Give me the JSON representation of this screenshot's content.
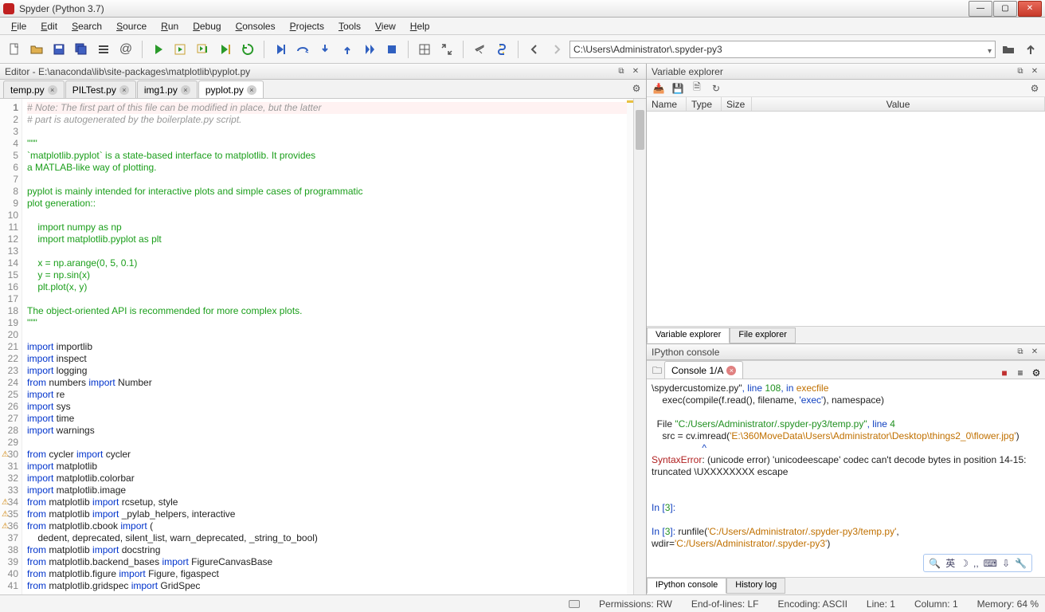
{
  "window": {
    "title": "Spyder (Python 3.7)"
  },
  "menubar": [
    "File",
    "Edit",
    "Search",
    "Source",
    "Run",
    "Debug",
    "Consoles",
    "Projects",
    "Tools",
    "View",
    "Help"
  ],
  "path": "C:\\Users\\Administrator\\.spyder-py3",
  "editor": {
    "pane_title": "Editor - E:\\anaconda\\lib\\site-packages\\matplotlib\\pyplot.py",
    "tabs": [
      {
        "label": "temp.py",
        "active": false
      },
      {
        "label": "PILTest.py",
        "active": false
      },
      {
        "label": "img1.py",
        "active": false
      },
      {
        "label": "pyplot.py",
        "active": true
      }
    ],
    "lines": [
      {
        "n": 1,
        "cls": "c-comm",
        "text": "# Note: The first part of this file can be modified in place, but the latter",
        "first": true
      },
      {
        "n": 2,
        "cls": "c-comm",
        "text": "# part is autogenerated by the boilerplate.py script."
      },
      {
        "n": 3,
        "cls": "",
        "text": ""
      },
      {
        "n": 4,
        "cls": "c-str",
        "text": "\"\"\""
      },
      {
        "n": 5,
        "cls": "c-str",
        "text": "`matplotlib.pyplot` is a state-based interface to matplotlib. It provides"
      },
      {
        "n": 6,
        "cls": "c-str",
        "text": "a MATLAB-like way of plotting."
      },
      {
        "n": 7,
        "cls": "",
        "text": ""
      },
      {
        "n": 8,
        "cls": "c-str",
        "text": "pyplot is mainly intended for interactive plots and simple cases of programmatic"
      },
      {
        "n": 9,
        "cls": "c-str",
        "text": "plot generation::"
      },
      {
        "n": 10,
        "cls": "",
        "text": ""
      },
      {
        "n": 11,
        "cls": "c-str",
        "text": "    import numpy as np"
      },
      {
        "n": 12,
        "cls": "c-str",
        "text": "    import matplotlib.pyplot as plt"
      },
      {
        "n": 13,
        "cls": "",
        "text": ""
      },
      {
        "n": 14,
        "cls": "c-str",
        "text": "    x = np.arange(0, 5, 0.1)"
      },
      {
        "n": 15,
        "cls": "c-str",
        "text": "    y = np.sin(x)"
      },
      {
        "n": 16,
        "cls": "c-str",
        "text": "    plt.plot(x, y)"
      },
      {
        "n": 17,
        "cls": "",
        "text": ""
      },
      {
        "n": 18,
        "cls": "c-str",
        "text": "The object-oriented API is recommended for more complex plots."
      },
      {
        "n": 19,
        "cls": "c-str",
        "text": "\"\"\""
      },
      {
        "n": 20,
        "cls": "",
        "text": ""
      },
      {
        "n": 21,
        "cls": "mix",
        "html": "<span class=c-kw>import</span> importlib"
      },
      {
        "n": 22,
        "cls": "mix",
        "html": "<span class=c-kw>import</span> inspect"
      },
      {
        "n": 23,
        "cls": "mix",
        "html": "<span class=c-kw>import</span> logging"
      },
      {
        "n": 24,
        "cls": "mix",
        "html": "<span class=c-kw>from</span> numbers <span class=c-kw>import</span> Number"
      },
      {
        "n": 25,
        "cls": "mix",
        "html": "<span class=c-kw>import</span> re"
      },
      {
        "n": 26,
        "cls": "mix",
        "html": "<span class=c-kw>import</span> sys"
      },
      {
        "n": 27,
        "cls": "mix",
        "html": "<span class=c-kw>import</span> time"
      },
      {
        "n": 28,
        "cls": "mix",
        "html": "<span class=c-kw>import</span> warnings"
      },
      {
        "n": 29,
        "cls": "",
        "text": ""
      },
      {
        "n": 30,
        "cls": "mix",
        "html": "<span class=c-kw>from</span> cycler <span class=c-kw>import</span> cycler",
        "warn": true
      },
      {
        "n": 31,
        "cls": "mix",
        "html": "<span class=c-kw>import</span> matplotlib"
      },
      {
        "n": 32,
        "cls": "mix",
        "html": "<span class=c-kw>import</span> matplotlib.colorbar"
      },
      {
        "n": 33,
        "cls": "mix",
        "html": "<span class=c-kw>import</span> matplotlib.image"
      },
      {
        "n": 34,
        "cls": "mix",
        "html": "<span class=c-kw>from</span> matplotlib <span class=c-kw>import</span> rcsetup, style",
        "warn": true
      },
      {
        "n": 35,
        "cls": "mix",
        "html": "<span class=c-kw>from</span> matplotlib <span class=c-kw>import</span> _pylab_helpers, interactive",
        "warn": true
      },
      {
        "n": 36,
        "cls": "mix",
        "html": "<span class=c-kw>from</span> matplotlib.cbook <span class=c-kw>import</span> (",
        "warn": true
      },
      {
        "n": 37,
        "cls": "c-none",
        "text": "    dedent, deprecated, silent_list, warn_deprecated, _string_to_bool)"
      },
      {
        "n": 38,
        "cls": "mix",
        "html": "<span class=c-kw>from</span> matplotlib <span class=c-kw>import</span> docstring"
      },
      {
        "n": 39,
        "cls": "mix",
        "html": "<span class=c-kw>from</span> matplotlib.backend_bases <span class=c-kw>import</span> FigureCanvasBase"
      },
      {
        "n": 40,
        "cls": "mix",
        "html": "<span class=c-kw>from</span> matplotlib.figure <span class=c-kw>import</span> Figure, figaspect"
      },
      {
        "n": 41,
        "cls": "mix",
        "html": "<span class=c-kw>from</span> matplotlib.gridspec <span class=c-kw>import</span> GridSpec"
      }
    ]
  },
  "varexp": {
    "title": "Variable explorer",
    "columns": [
      "Name",
      "Type",
      "Size",
      "Value"
    ],
    "bottom_tabs": [
      "Variable explorer",
      "File explorer"
    ]
  },
  "ipython": {
    "title": "IPython console",
    "tab": "Console 1/A",
    "content": [
      {
        "cls": "",
        "html": "\\spydercustomize.py\"<span class=blue>, line </span><span class=grn>108</span><span class=blue>, in </span><span class=orange>execfile</span>"
      },
      {
        "cls": "",
        "html": "    exec(compile(f.read(), filename, <span class=blue>'exec'</span>), namespace)"
      },
      {
        "cls": "",
        "html": ""
      },
      {
        "cls": "",
        "html": "  File <span class=grn>\"C:/Users/Administrator/.spyder-py3/temp.py\"</span><span class=blue>, line </span><span class=grn>4</span>"
      },
      {
        "cls": "",
        "html": "    src = cv.imread(<span class=orange>'E:\\360MoveData\\Users\\Administrator\\Desktop\\things2_0\\flower.jpg'</span>)"
      },
      {
        "cls": "",
        "html": "                   <span class=blue>^</span>"
      },
      {
        "cls": "",
        "html": "<span class=red>SyntaxError</span>: (unicode error) 'unicodeescape' codec can't decode bytes in position 14-15: truncated \\UXXXXXXXX escape"
      },
      {
        "cls": "",
        "html": ""
      },
      {
        "cls": "",
        "html": ""
      },
      {
        "cls": "",
        "html": "<span class=blue>In [</span><span class=grn>3</span><span class=blue>]:</span>"
      },
      {
        "cls": "",
        "html": ""
      },
      {
        "cls": "",
        "html": "<span class=blue>In [</span><span class=grn>3</span><span class=blue>]:</span> runfile(<span class=orange>'C:/Users/Administrator/.spyder-py3/temp.py'</span>, wdir=<span class=orange>'C:/Users/Administrator/.spyder-py3'</span>)"
      }
    ],
    "bottom_tabs": [
      "IPython console",
      "History log"
    ],
    "ime": "英"
  },
  "status": {
    "permissions": "Permissions: RW",
    "eol": "End-of-lines: LF",
    "encoding": "Encoding: ASCII",
    "line": "Line: 1",
    "column": "Column: 1",
    "memory": "Memory: 64 %"
  }
}
